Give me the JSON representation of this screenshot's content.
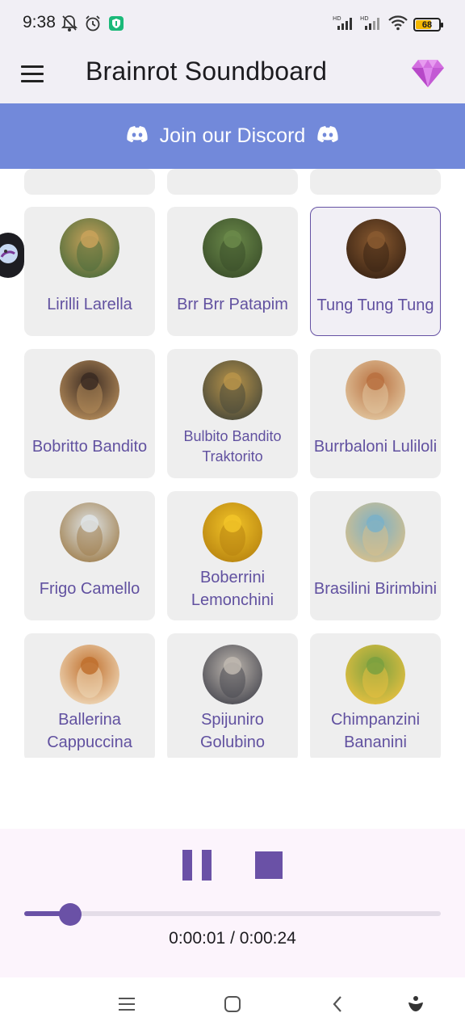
{
  "status_bar": {
    "time": "9:38",
    "battery": "68",
    "battery_level": 0.68
  },
  "app_bar": {
    "title": "Brainrot Soundboard"
  },
  "discord": {
    "label": "Join our Discord"
  },
  "sounds": [
    {
      "name": "Lirilli Larella",
      "selected": false,
      "colors": [
        "#c9a25a",
        "#4e6d3c"
      ]
    },
    {
      "name": "Brr Brr Patapim",
      "selected": false,
      "colors": [
        "#6b8a4a",
        "#3b4f2a"
      ]
    },
    {
      "name": "Tung Tung Tung",
      "selected": true,
      "colors": [
        "#8a5a30",
        "#3a2414"
      ]
    },
    {
      "name": "Bobritto Bandito",
      "selected": false,
      "colors": [
        "#3a2a22",
        "#b58c5a"
      ]
    },
    {
      "name": "Bulbito Bandito Traktorito",
      "selected": false,
      "colors": [
        "#b8944a",
        "#4a4a3a"
      ]
    },
    {
      "name": "Burrbaloni Luliloli",
      "selected": false,
      "colors": [
        "#b87040",
        "#e2c7a0"
      ]
    },
    {
      "name": "Frigo Camello",
      "selected": false,
      "colors": [
        "#dfe4e6",
        "#a08050"
      ]
    },
    {
      "name": "Boberrini Lemonchini",
      "selected": false,
      "colors": [
        "#f2c428",
        "#b88410"
      ]
    },
    {
      "name": "Brasilini Birimbini",
      "selected": false,
      "colors": [
        "#7ab0c8",
        "#d9c08a"
      ]
    },
    {
      "name": "Ballerina Cappuccina",
      "selected": false,
      "colors": [
        "#c0702e",
        "#efd8b8"
      ]
    },
    {
      "name": "Spijuniro Golubino",
      "selected": false,
      "colors": [
        "#bfb8b0",
        "#4a4a52"
      ]
    },
    {
      "name": "Chimpanzini Bananini",
      "selected": false,
      "colors": [
        "#7aa040",
        "#e8c040"
      ]
    }
  ],
  "player": {
    "state": "playing",
    "current_time": "0:00:01",
    "separator": "/",
    "total_time": "0:00:24",
    "progress": 0.07
  },
  "colors": {
    "accent": "#6a51a6",
    "discord": "#7289da",
    "tile_bg": "#eeeeee",
    "app_bar_bg": "#f1eff5",
    "player_bg": "#fcf4fc"
  },
  "icons": {
    "menu": "hamburger-menu-icon",
    "premium": "diamond-icon",
    "discord": "discord-logo-icon",
    "pause": "pause-icon",
    "stop": "stop-icon",
    "nav_recents": "recents-icon",
    "nav_home": "home-icon",
    "nav_back": "back-icon",
    "nav_assistant": "assistant-icon"
  }
}
